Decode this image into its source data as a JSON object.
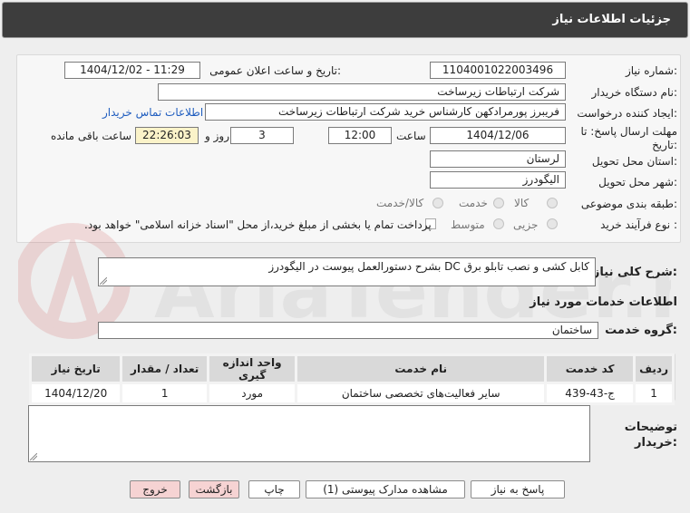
{
  "window": {
    "title": "جزئیات اطلاعات نیاز"
  },
  "form": {
    "need_number_label": "شماره نیاز:",
    "need_number": "1104001022003496",
    "announce_label": "تاریخ و ساعت اعلان عمومی:",
    "announce_value": "1404/12/02 - 11:29",
    "buyer_org_label": "نام دستگاه خریدار:",
    "buyer_org": "شرکت ارتباطات زیرساخت",
    "requester_label": "ایجاد کننده درخواست:",
    "requester": "فریبرز پورمرادکهن کارشناس خرید شرکت ارتباطات زیرساخت",
    "contact_link": "اطلاعات تماس خریدار",
    "deadline_label": "مهلت ارسال پاسخ: تا تاریخ:",
    "deadline_date": "1404/12/06",
    "time_label": "ساعت",
    "deadline_time": "12:00",
    "days_value": "3",
    "days_label": "روز و",
    "remaining_time": "22:26:03",
    "remaining_label": "ساعت باقی مانده",
    "province_label": "استان محل تحویل:",
    "province": "لرستان",
    "city_label": "شهر محل تحویل:",
    "city": "الیگودرز",
    "category_label": "طبقه بندی موضوعی:",
    "category_options": [
      "کالا",
      "خدمت",
      "کالا/خدمت"
    ],
    "process_label": "نوع فرآیند خرید :",
    "process_options": [
      "جزیی",
      "متوسط"
    ],
    "payment_note": "پرداخت تمام یا بخشی از مبلغ خرید،از محل \"اسناد خزانه اسلامی\" خواهد بود."
  },
  "summary": {
    "label": "شرح کلی نیاز:",
    "text": "کابل کشی و نصب تابلو برق DC بشرح دستورالعمل پیوست در الیگودرز"
  },
  "services": {
    "section_title": "اطلاعات خدمات مورد نیاز",
    "group_label": "گروه خدمت:",
    "group_value": "ساختمان",
    "headers": [
      "ردیف",
      "کد خدمت",
      "نام خدمت",
      "واحد اندازه گیری",
      "تعداد / مقدار",
      "تاریخ نیاز"
    ],
    "rows": [
      [
        "1",
        "ج-43-439",
        "سایر فعالیت‌های تخصصی ساختمان",
        "مورد",
        "1",
        "1404/12/20"
      ]
    ]
  },
  "notes": {
    "label": "توضیحات خریدار:",
    "value": ""
  },
  "buttons": {
    "reply": "پاسخ به نیاز",
    "attachments": "مشاهده مدارک پیوستی (1)",
    "print": "چاپ",
    "back": "بازگشت",
    "exit": "خروج"
  },
  "watermark": {
    "text": "AriaTender.net"
  },
  "colors": {
    "header_bg": "#3d3d3d",
    "link": "#1f5dbf",
    "yellow_field": "#fbf3c9",
    "pink_button": "#f6d3d3"
  }
}
